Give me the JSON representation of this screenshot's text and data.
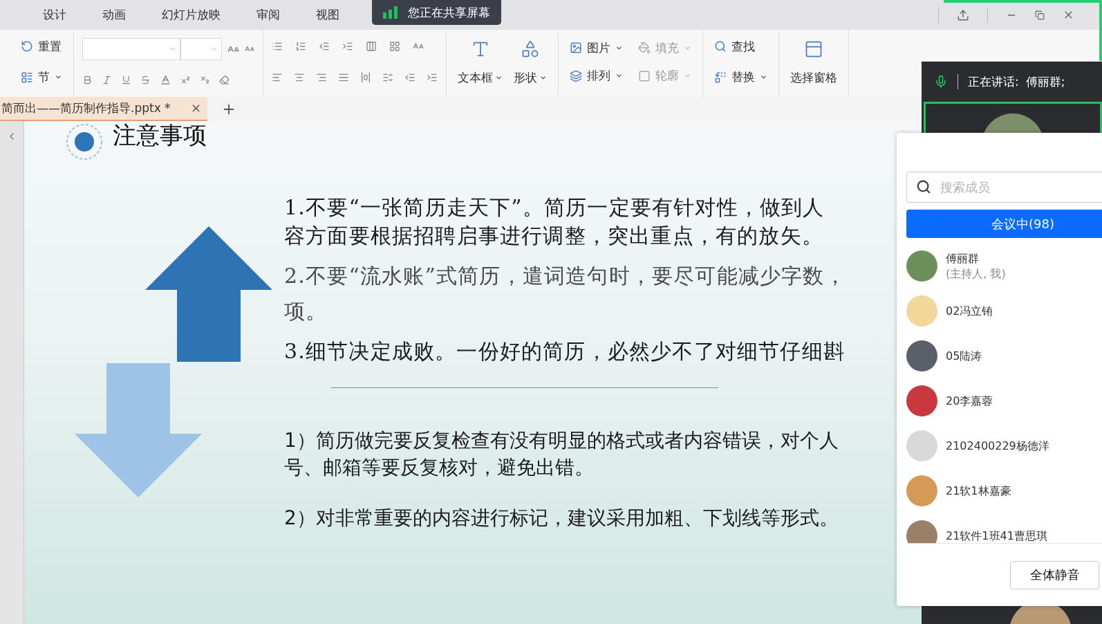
{
  "menu_tabs": [
    "设计",
    "动画",
    "幻灯片放映",
    "审阅",
    "视图"
  ],
  "share_badge": "您正在共享屏幕",
  "ribbon": {
    "groups": [
      {
        "kind": "rows",
        "items": [
          {
            "label": "重置",
            "dropdown": false,
            "disabled": false
          },
          {
            "label": "节",
            "dropdown": true,
            "disabled": false
          }
        ]
      },
      {
        "kind": "font"
      },
      {
        "kind": "paragraph"
      },
      {
        "kind": "large",
        "items": [
          {
            "label": "文本框",
            "dropdown": true,
            "disabled": false
          },
          {
            "label": "形状",
            "dropdown": true,
            "disabled": false
          }
        ]
      },
      {
        "kind": "grid",
        "items": [
          {
            "label": "图片",
            "dropdown": true,
            "disabled": false
          },
          {
            "label": "填充",
            "dropdown": true,
            "disabled": true
          },
          {
            "label": "排列",
            "dropdown": true,
            "disabled": false
          },
          {
            "label": "轮廓",
            "dropdown": true,
            "disabled": true
          }
        ]
      },
      {
        "kind": "rows",
        "items": [
          {
            "label": "查找",
            "dropdown": false,
            "disabled": false
          },
          {
            "label": "替换",
            "dropdown": true,
            "disabled": false
          }
        ]
      },
      {
        "kind": "large",
        "items": [
          {
            "label": "选择窗格",
            "dropdown": false,
            "disabled": false
          }
        ]
      }
    ]
  },
  "document_tab": {
    "title": "简而出——简历制作指导.pptx *",
    "selected": true
  },
  "slide": {
    "title": "注意事项",
    "paragraphs": [
      {
        "kind": "serif",
        "muted": false,
        "lines": [
          "1.不要“一张简历走天下”。简历一定要有针对性，做到人",
          "容方面要根据招聘启事进行调整，突出重点，有的放矢。"
        ]
      },
      {
        "kind": "serif",
        "muted": true,
        "lines": [
          "2.不要“流水账”式简历，遣词造句时，要尽可能减少字数，",
          "项。"
        ]
      },
      {
        "kind": "serif",
        "muted": false,
        "lines": [
          "3.细节决定成败。一份好的简历，必然少不了对细节仔细斟"
        ]
      },
      {
        "kind": "rule"
      },
      {
        "kind": "sans",
        "muted": false,
        "lines": [
          "1）简历做完要反复检查有没有明显的格式或者内容错误，对个人",
          "号、邮箱等要反复核对，避免出错。"
        ]
      },
      {
        "kind": "sans",
        "muted": false,
        "lines": [
          "2）对非常重要的内容进行标记，建议采用加粗、下划线等形式。"
        ]
      }
    ]
  },
  "meeting": {
    "speaking_label": "正在讲话:",
    "speaker": "傅丽群;",
    "search_placeholder": "搜索成员",
    "tab": "会议中(98)",
    "members": [
      {
        "name": "傅丽群",
        "role": "(主持人, 我)"
      },
      {
        "name": "02冯立铕"
      },
      {
        "name": "05陆涛"
      },
      {
        "name": "20李嘉蓉"
      },
      {
        "name": "2102400229杨德洋"
      },
      {
        "name": "21软1林嘉豪"
      },
      {
        "name": "21软件1班41曹思琪"
      }
    ],
    "mute_all": "全体静音"
  }
}
